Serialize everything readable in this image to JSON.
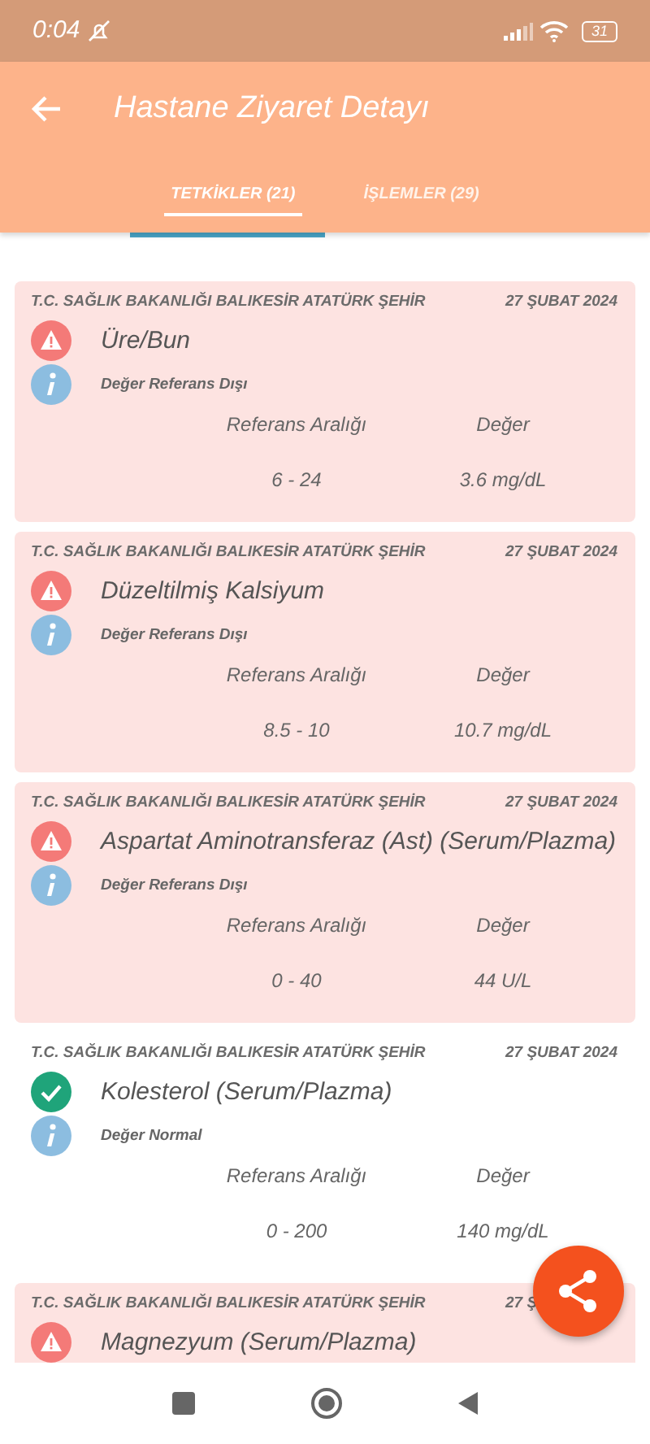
{
  "status_bar": {
    "time": "0:04",
    "battery": "31"
  },
  "header": {
    "title": "Hastane Ziyaret Detayı"
  },
  "tabs": [
    {
      "label": "TETKİKLER (21)",
      "selected": true
    },
    {
      "label": "İŞLEMLER (29)",
      "selected": false
    }
  ],
  "results": [
    {
      "hospital": "T.C. SAĞLIK BAKANLIĞI BALIKESİR ATATÜRK ŞEHİR",
      "date": "27 ŞUBAT 2024",
      "kind": "abnormal",
      "test": "Üre/Bun",
      "status": "Değer Referans Dışı",
      "range_label": "Referans Aralığı",
      "value_label": "Değer",
      "range": "6 - 24",
      "value": "3.6 mg/dL"
    },
    {
      "hospital": "T.C. SAĞLIK BAKANLIĞI BALIKESİR ATATÜRK ŞEHİR",
      "date": "27 ŞUBAT 2024",
      "kind": "abnormal",
      "test": "Düzeltilmiş Kalsiyum",
      "status": "Değer Referans Dışı",
      "range_label": "Referans Aralığı",
      "value_label": "Değer",
      "range": "8.5 - 10",
      "value": "10.7 mg/dL"
    },
    {
      "hospital": "T.C. SAĞLIK BAKANLIĞI BALIKESİR ATATÜRK ŞEHİR",
      "date": "27 ŞUBAT 2024",
      "kind": "abnormal",
      "test": "Aspartat Aminotransferaz (Ast) (Serum/Plazma)",
      "status": "Değer Referans Dışı",
      "range_label": "Referans Aralığı",
      "value_label": "Değer",
      "range": "0 - 40",
      "value": "44 U/L"
    },
    {
      "hospital": "T.C. SAĞLIK BAKANLIĞI BALIKESİR ATATÜRK ŞEHİR",
      "date": "27 ŞUBAT 2024",
      "kind": "normal",
      "test": "Kolesterol (Serum/Plazma)",
      "status": "Değer Normal",
      "range_label": "Referans Aralığı",
      "value_label": "Değer",
      "range": "0 - 200",
      "value": "140 mg/dL"
    },
    {
      "hospital": "T.C. SAĞLIK BAKANLIĞI BALIKESİR ATATÜRK ŞEHİR",
      "date": "27 Ş",
      "kind": "abnormal",
      "test": "Magnezyum (Serum/Plazma)"
    }
  ]
}
